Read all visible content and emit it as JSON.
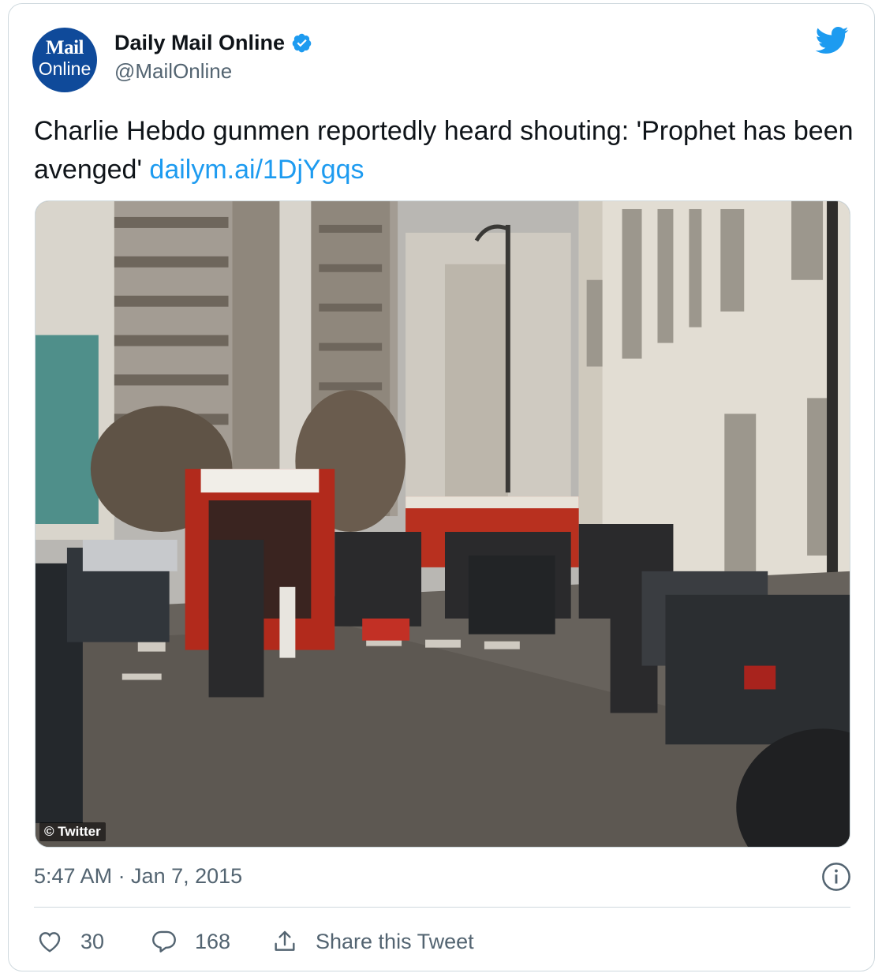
{
  "account": {
    "avatar_line1": "Mail",
    "avatar_line2": "Online",
    "name": "Daily Mail Online",
    "handle": "@MailOnline",
    "verified": true
  },
  "tweet": {
    "text": "Charlie Hebdo gunmen reportedly heard shouting: 'Prophet has been avenged'",
    "link": "dailym.ai/1DjYgqs"
  },
  "media": {
    "credit": "© Twitter"
  },
  "meta": {
    "timestamp": "5:47 AM · Jan 7, 2015"
  },
  "actions": {
    "likes": "30",
    "replies": "168",
    "share_label": "Share this Tweet"
  },
  "colors": {
    "link": "#1d9bf0",
    "twitter_blue": "#1d9bf0",
    "secondary_text": "#536471",
    "border": "#cfd9de",
    "avatar_bg": "#0f4a9a"
  },
  "icons": {
    "brand": "twitter-bird-icon",
    "verified": "verified-badge-icon",
    "info": "info-icon",
    "like": "heart-icon",
    "reply": "reply-bubble-icon",
    "share": "share-upload-icon"
  }
}
